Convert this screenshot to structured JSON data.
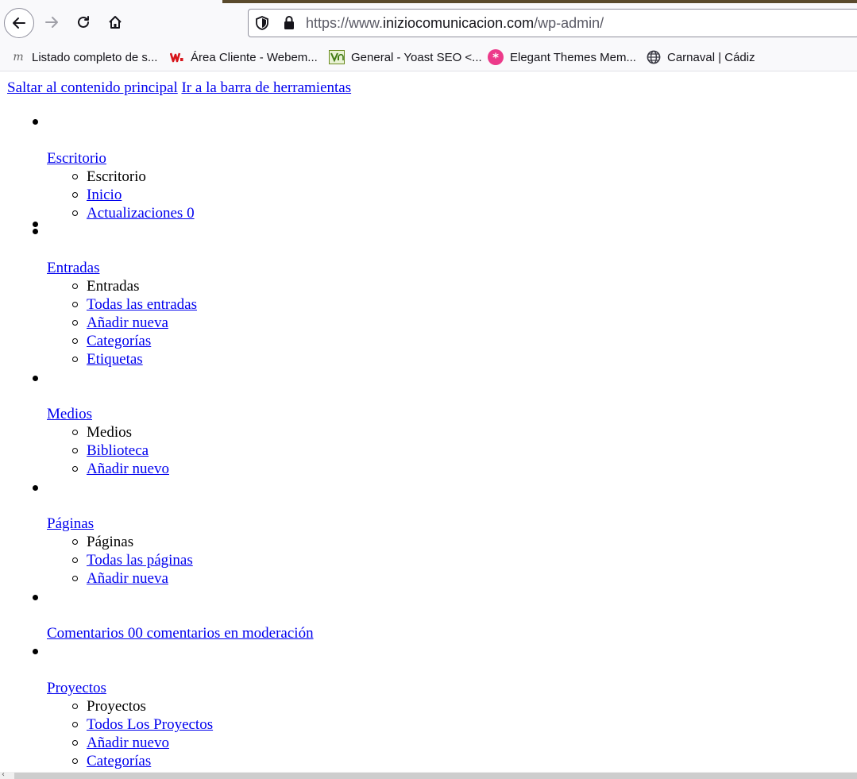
{
  "browser": {
    "url_prefix": "https://www.",
    "url_domain": "iniziocomunicacion.com",
    "url_path": "/wp-admin/",
    "bookmarks": [
      {
        "label": "Listado completo de s...",
        "icon": "m-script-icon"
      },
      {
        "label": "Área Cliente - Webem...",
        "icon": "webempresa-icon"
      },
      {
        "label": "General - Yoast SEO <...",
        "icon": "yoast-icon"
      },
      {
        "label": "Elegant Themes Mem...",
        "icon": "elegant-themes-icon"
      },
      {
        "label": "Carnaval | Cádiz",
        "icon": "globe-icon"
      }
    ]
  },
  "skip_links": {
    "main": "Saltar al contenido principal",
    "toolbar": "Ir a la barra de herramientas"
  },
  "menu": [
    {
      "label": "Escritorio",
      "sub_header": "Escritorio",
      "links": [
        "Inicio",
        "Actualizaciones 0"
      ]
    },
    {
      "label": "Entradas",
      "sub_header": "Entradas",
      "links": [
        "Todas las entradas",
        "Añadir nueva",
        "Categorías",
        "Etiquetas"
      ]
    },
    {
      "label": "Medios",
      "sub_header": "Medios",
      "links": [
        "Biblioteca",
        "Añadir nuevo"
      ]
    },
    {
      "label": "Páginas",
      "sub_header": "Páginas",
      "links": [
        "Todas las páginas",
        "Añadir nueva"
      ]
    },
    {
      "label": "Comentarios 00 comentarios en moderación"
    },
    {
      "label": "Proyectos",
      "sub_header": "Proyectos",
      "links": [
        "Todos Los Proyectos",
        "Añadir nuevo",
        "Categorías"
      ]
    }
  ],
  "colors": {
    "link": "#0000ee",
    "text": "#000000",
    "chrome": "#f9f9fb"
  }
}
